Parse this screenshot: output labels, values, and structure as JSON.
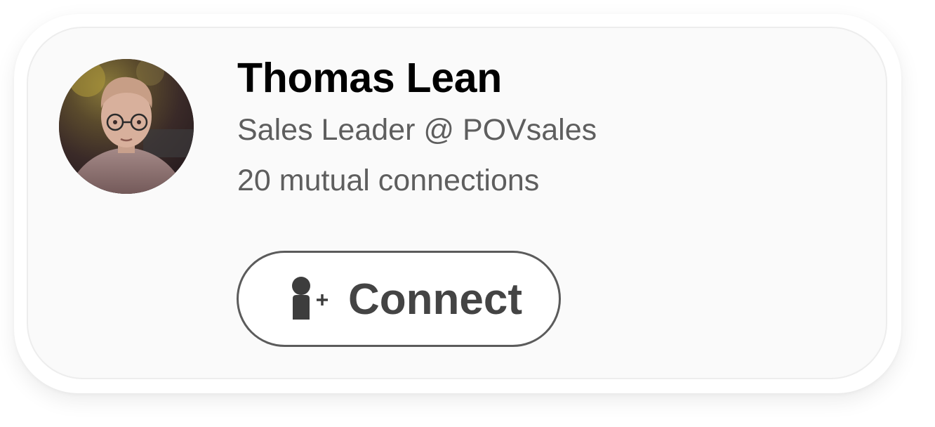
{
  "profile": {
    "name": "Thomas Lean",
    "headline": "Sales Leader @ POVsales",
    "mutual_connections": "20 mutual connections"
  },
  "actions": {
    "connect_label": "Connect",
    "connect_icon": "add-person-icon"
  },
  "colors": {
    "card_background": "#fafafa",
    "name_text": "#000000",
    "secondary_text": "#5e5e5e",
    "button_border": "#5b5b5b",
    "button_text": "#444444"
  }
}
